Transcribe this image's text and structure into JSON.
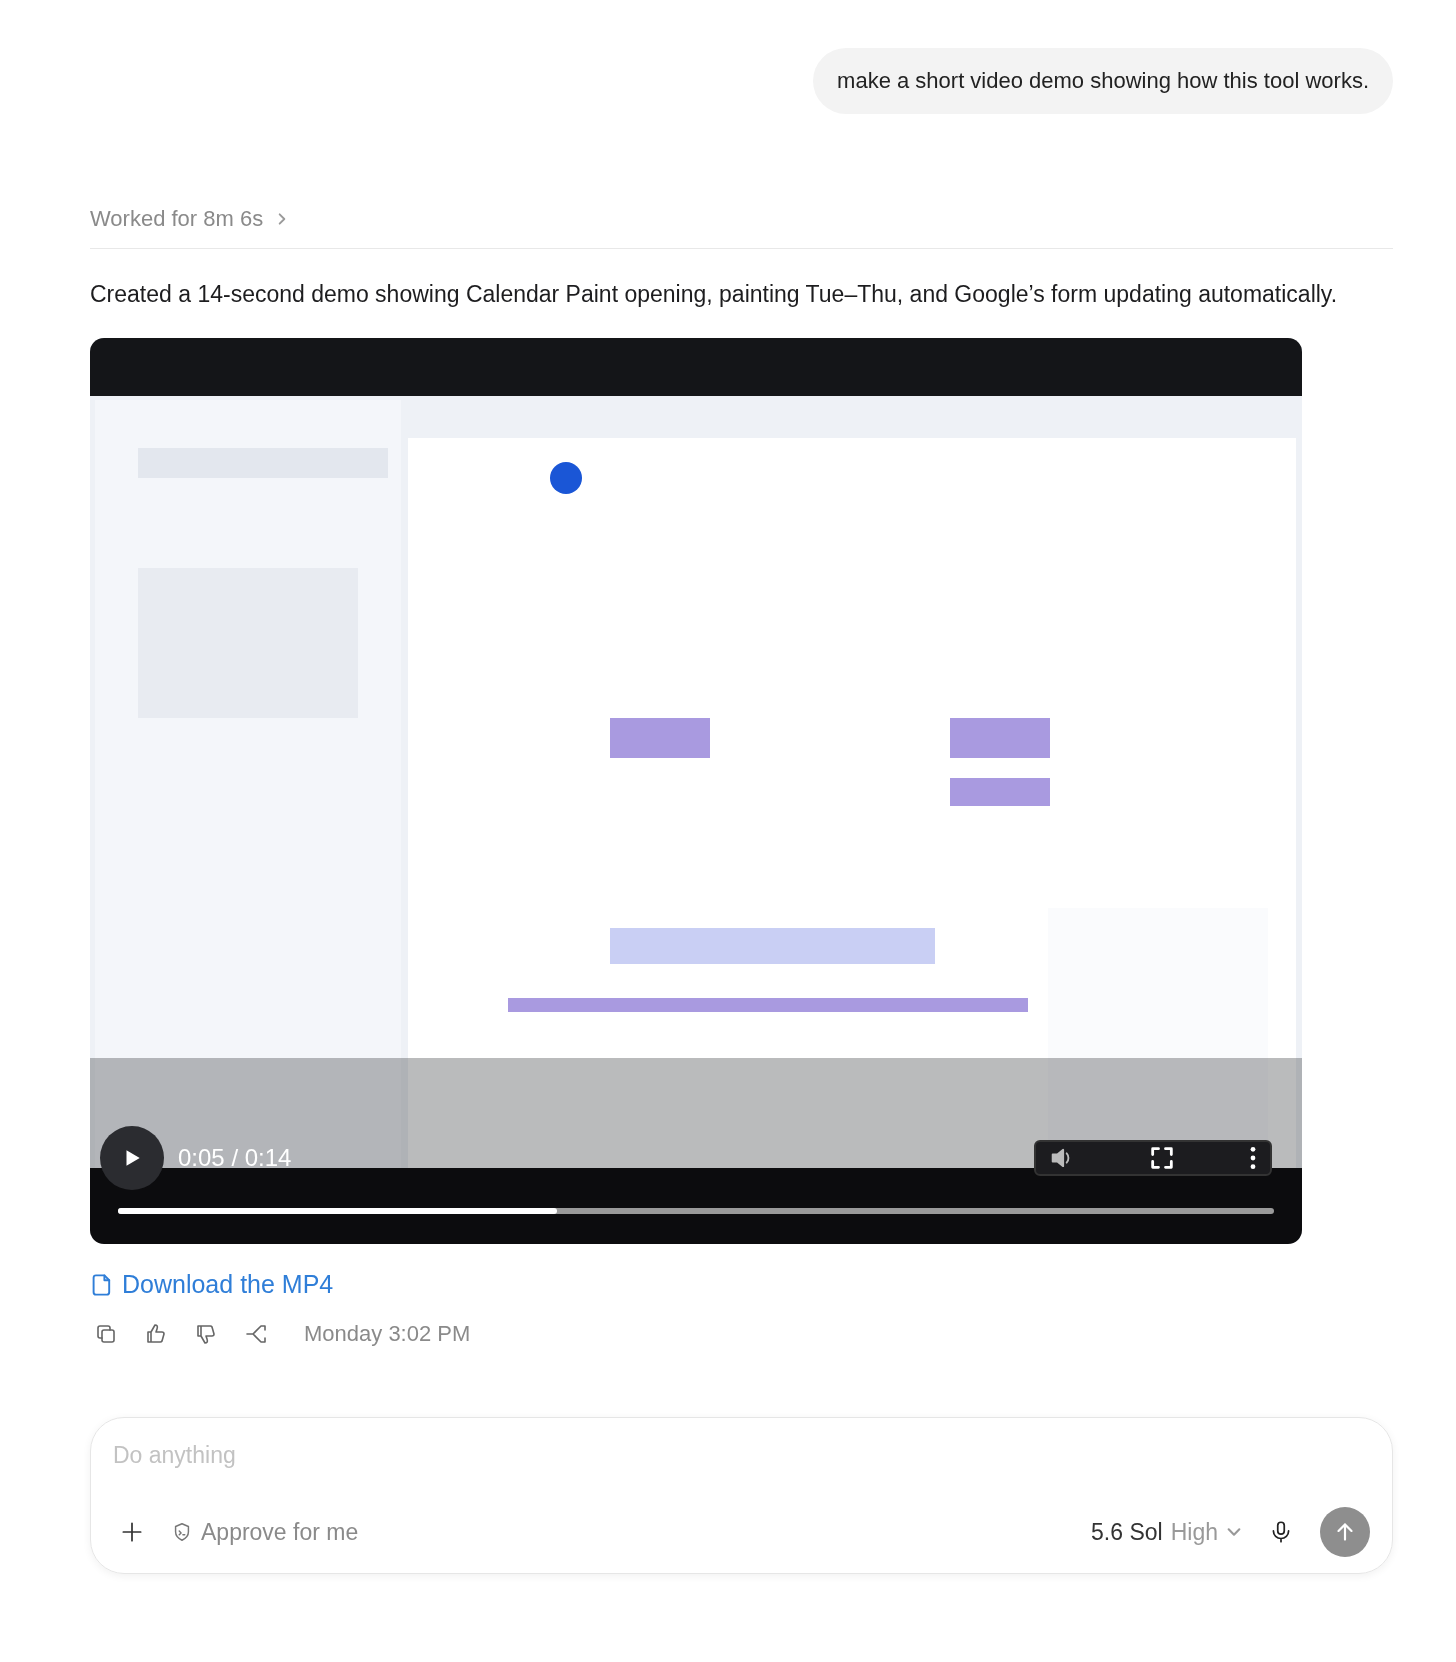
{
  "user_message": "make a short video demo showing how this tool works.",
  "worked": {
    "label": "Worked for 8m 6s",
    "expanded": false
  },
  "reply": "Created a 14-second demo showing Calendar Paint opening, painting Tue–Thu, and Google’s form updating automatically.",
  "video": {
    "playing": false,
    "time": "0:05 / 0:14",
    "level": 0.38
  },
  "download": {
    "label": "Download the MP4"
  },
  "timestamp": "Monday 3:02 PM",
  "composer": {
    "placeholder": "Do anything",
    "approve": "Approve for me",
    "model": "5.6 Sol",
    "effort": "High"
  }
}
